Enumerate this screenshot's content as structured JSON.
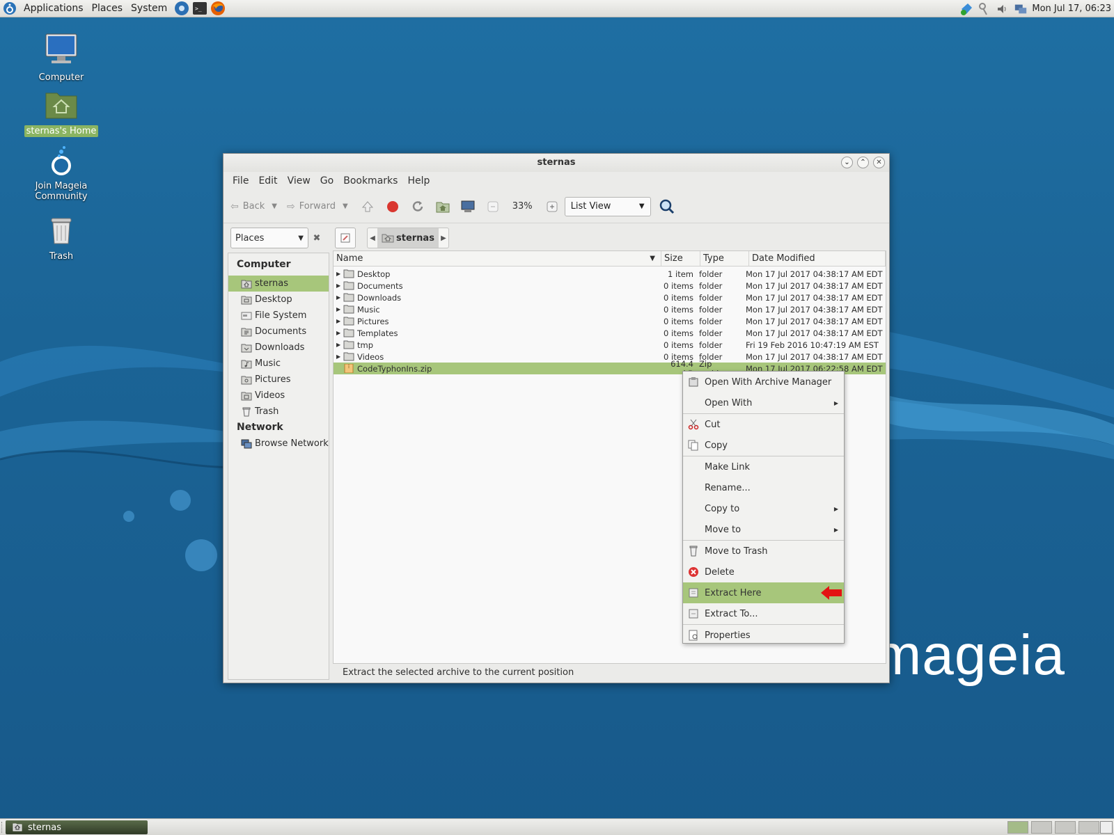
{
  "top_panel": {
    "menus": [
      "Applications",
      "Places",
      "System"
    ],
    "clock": "Mon Jul 17, 06:23"
  },
  "desktop_icons": [
    {
      "label": "Computer"
    },
    {
      "label": "sternas's Home"
    },
    {
      "label": "Join Mageia Community"
    },
    {
      "label": "Trash"
    }
  ],
  "wallpaper_text": "mageia",
  "window": {
    "title": "sternas",
    "menubar": [
      "File",
      "Edit",
      "View",
      "Go",
      "Bookmarks",
      "Help"
    ],
    "toolbar": {
      "back": "Back",
      "forward": "Forward",
      "zoom": "33%",
      "view_mode": "List View"
    },
    "location": {
      "places_label": "Places",
      "breadcrumb": "sternas"
    },
    "sidebar": {
      "computer_heading": "Computer",
      "items": [
        "sternas",
        "Desktop",
        "File System",
        "Documents",
        "Downloads",
        "Music",
        "Pictures",
        "Videos",
        "Trash"
      ],
      "network_heading": "Network",
      "network_items": [
        "Browse Network"
      ]
    },
    "columns": [
      "Name",
      "Size",
      "Type",
      "Date Modified"
    ],
    "rows": [
      {
        "name": "Desktop",
        "size": "1 item",
        "type": "folder",
        "date": "Mon 17 Jul 2017 04:38:17 AM EDT"
      },
      {
        "name": "Documents",
        "size": "0 items",
        "type": "folder",
        "date": "Mon 17 Jul 2017 04:38:17 AM EDT"
      },
      {
        "name": "Downloads",
        "size": "0 items",
        "type": "folder",
        "date": "Mon 17 Jul 2017 04:38:17 AM EDT"
      },
      {
        "name": "Music",
        "size": "0 items",
        "type": "folder",
        "date": "Mon 17 Jul 2017 04:38:17 AM EDT"
      },
      {
        "name": "Pictures",
        "size": "0 items",
        "type": "folder",
        "date": "Mon 17 Jul 2017 04:38:17 AM EDT"
      },
      {
        "name": "Templates",
        "size": "0 items",
        "type": "folder",
        "date": "Mon 17 Jul 2017 04:38:17 AM EDT"
      },
      {
        "name": "tmp",
        "size": "0 items",
        "type": "folder",
        "date": "Fri 19 Feb 2016 10:47:19 AM EST"
      },
      {
        "name": "Videos",
        "size": "0 items",
        "type": "folder",
        "date": "Mon 17 Jul 2017 04:38:17 AM EDT"
      },
      {
        "name": "CodeTyphonIns.zip",
        "size": "614.4 kB",
        "type": "Zip archive",
        "date": "Mon 17 Jul 2017 06:22:58 AM EDT"
      }
    ],
    "status": "Extract the selected archive to the current position"
  },
  "context_menu": {
    "items": [
      {
        "label": "Open With Archive Manager"
      },
      {
        "label": "Open With"
      },
      {
        "label": "Cut"
      },
      {
        "label": "Copy"
      },
      {
        "label": "Make Link"
      },
      {
        "label": "Rename..."
      },
      {
        "label": "Copy to"
      },
      {
        "label": "Move to"
      },
      {
        "label": "Move to Trash"
      },
      {
        "label": "Delete"
      },
      {
        "label": "Extract Here"
      },
      {
        "label": "Extract To..."
      },
      {
        "label": "Properties"
      }
    ]
  },
  "bottom_panel": {
    "task": "sternas"
  },
  "colors": {
    "selection": "#a7c67b",
    "desktop_blue": "#1b6496"
  }
}
